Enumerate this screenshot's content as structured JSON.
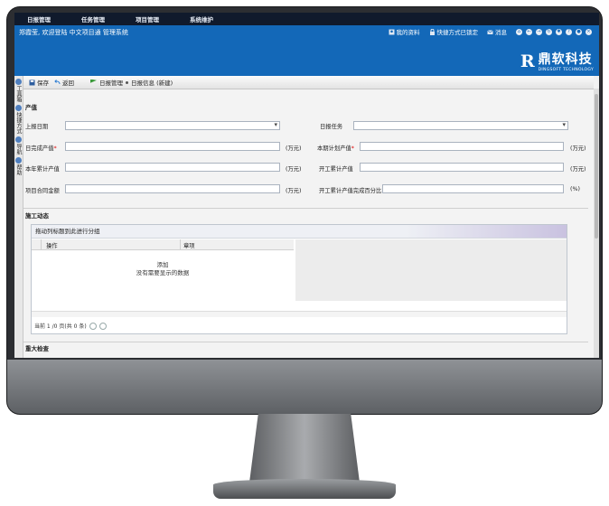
{
  "nav": {
    "items": [
      "日报管理",
      "任务管理",
      "项目管理",
      "系统维护"
    ]
  },
  "header": {
    "welcome": "郑霞莹, 欢迎登陆  中文项目通  管理系统",
    "links": {
      "profile": "我的资料",
      "shortcut": "快捷方式已锁定",
      "message": "消息"
    },
    "logo": {
      "mark": "R",
      "cn": "鼎软科技",
      "en": "DINGSOFT TECHNOLOGY"
    }
  },
  "sidebar": {
    "tabs": [
      "工具箱",
      "快捷方式",
      "导航",
      "帮助"
    ]
  },
  "toolbar": {
    "save": "保存",
    "back": "返回",
    "crumb1": "日报管理",
    "crumb2": "日报信息 (新建)"
  },
  "form": {
    "section1": "产值",
    "report_date": "上报日期",
    "report_task": "日报任务",
    "daily_output": "日完成产值",
    "period_plan": "本期计划产值",
    "year_total": "本年累计产值",
    "start_total": "开工累计产值",
    "contract_amount": "项目合同金额",
    "start_percent": "开工累计产值完成百分比",
    "unit_wan": "(万元)",
    "unit_pct": "(%)",
    "required_mark": "*"
  },
  "section2": "施工动态",
  "grid": {
    "group_hint": "拖动列标题到此进行分组",
    "columns": [
      "操作",
      "章项"
    ],
    "add": "添加",
    "empty": "没有需要显示的数据",
    "pager": "当前 1 /0 页(共 0 条)"
  },
  "section3": "重大检查"
}
